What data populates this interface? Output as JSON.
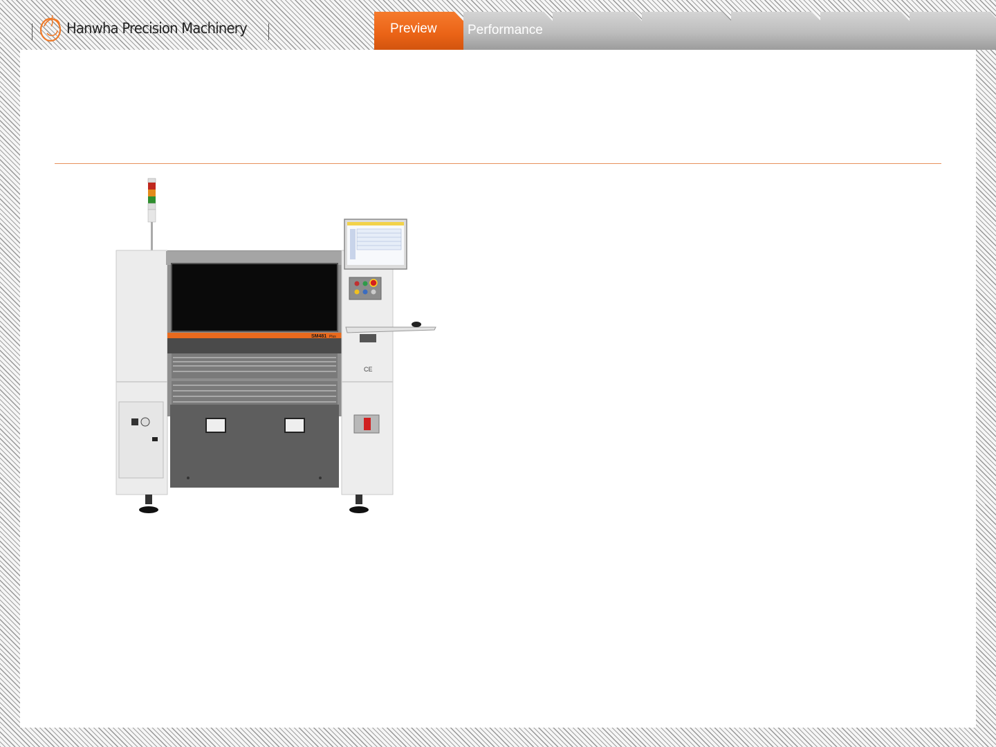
{
  "header": {
    "logo_text": "Hanwha Precision Machinery"
  },
  "tabs": [
    {
      "label": "Preview",
      "active": true
    },
    {
      "label": "Performance",
      "active": false
    },
    {
      "label": "",
      "active": false
    },
    {
      "label": "",
      "active": false
    },
    {
      "label": "",
      "active": false
    },
    {
      "label": "",
      "active": false
    },
    {
      "label": "",
      "active": false
    }
  ],
  "product": {
    "model_badge": "SM481",
    "model_suffix": "Plus",
    "ce_mark": "CE"
  },
  "colors": {
    "accent": "#ea6316",
    "rule": "#e8915c",
    "tab_inactive": "#bdbdbd"
  }
}
